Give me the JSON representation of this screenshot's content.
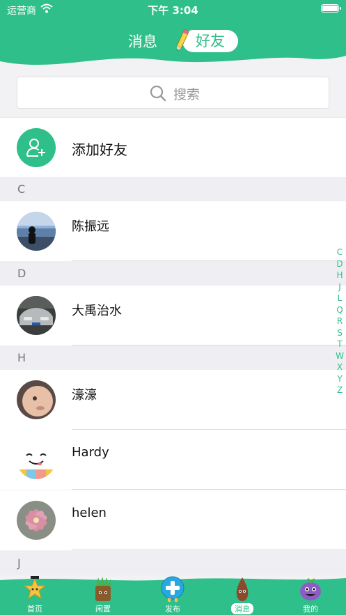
{
  "status": {
    "carrier": "运营商",
    "time": "下午 3:04"
  },
  "header": {
    "tab_messages": "消息",
    "tab_friends": "好友"
  },
  "search": {
    "placeholder": "搜索"
  },
  "add_friend": {
    "label": "添加好友"
  },
  "sections": [
    {
      "letter": "C",
      "contacts": [
        {
          "name": "陈振远"
        }
      ]
    },
    {
      "letter": "D",
      "contacts": [
        {
          "name": "大禹治水"
        }
      ]
    },
    {
      "letter": "H",
      "contacts": [
        {
          "name": "濠濠"
        },
        {
          "name": "Hardy"
        },
        {
          "name": "helen"
        }
      ]
    },
    {
      "letter": "J",
      "contacts": []
    }
  ],
  "index_letters": [
    "C",
    "D",
    "H",
    "J",
    "L",
    "Q",
    "R",
    "S",
    "T",
    "W",
    "X",
    "Y",
    "Z"
  ],
  "tabbar": [
    {
      "label": "首页",
      "icon": "star-mascot-icon"
    },
    {
      "label": "闲置",
      "icon": "plant-mascot-icon"
    },
    {
      "label": "发布",
      "icon": "plus-mascot-icon"
    },
    {
      "label": "消息",
      "icon": "drop-mascot-icon"
    },
    {
      "label": "我的",
      "icon": "grape-mascot-icon"
    }
  ],
  "colors": {
    "accent": "#2fbf8a",
    "index": "#2fbf8a"
  }
}
